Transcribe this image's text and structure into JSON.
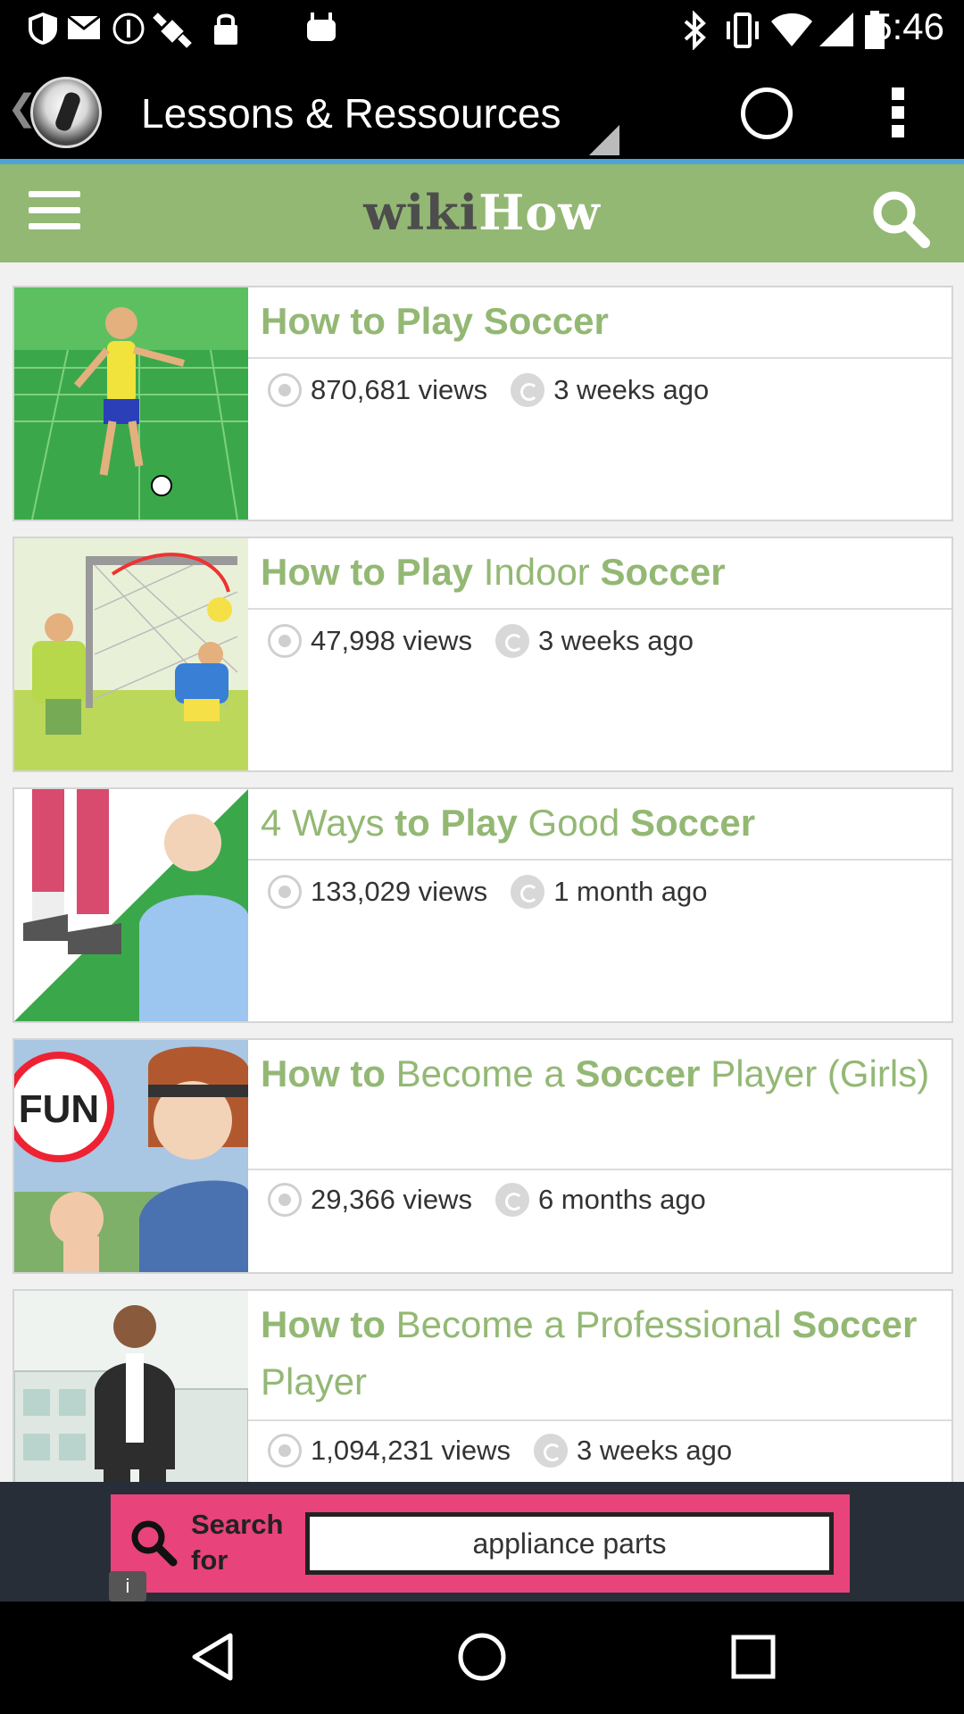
{
  "status_bar": {
    "time": "5:46",
    "left_icons": [
      "shield-icon",
      "gmail-icon",
      "info-icon",
      "fake-gps-icon",
      "lock-icon",
      "android-icon"
    ],
    "right_icons": [
      "bluetooth-icon",
      "vibrate-icon",
      "wifi-icon",
      "signal-icon",
      "battery-icon"
    ]
  },
  "app_bar": {
    "title": "Lessons & Ressources"
  },
  "wiki_header": {
    "logo_wiki": "wiki",
    "logo_how": "How",
    "brand_green": "#93b874"
  },
  "articles": [
    {
      "title_parts": [
        [
          "b",
          "How to Play Soccer"
        ]
      ],
      "views": "870,681 views",
      "time": "3 weeks ago"
    },
    {
      "title_parts": [
        [
          "b",
          "How to Play "
        ],
        [
          "n",
          "Indoor "
        ],
        [
          "b",
          "Soccer"
        ]
      ],
      "views": "47,998 views",
      "time": "3 weeks ago"
    },
    {
      "title_parts": [
        [
          "n",
          "4 Ways "
        ],
        [
          "b",
          "to Play "
        ],
        [
          "n",
          "Good "
        ],
        [
          "b",
          "Soccer"
        ]
      ],
      "views": "133,029 views",
      "time": "1 month ago"
    },
    {
      "title_parts": [
        [
          "b",
          "How to "
        ],
        [
          "n",
          "Become a "
        ],
        [
          "b",
          "Soccer "
        ],
        [
          "n",
          "Player (Girls)"
        ]
      ],
      "views": "29,366 views",
      "time": "6 months ago"
    },
    {
      "title_parts": [
        [
          "b",
          "How to "
        ],
        [
          "n",
          "Become a Professional "
        ],
        [
          "b",
          "Soccer "
        ],
        [
          "n",
          "Player"
        ]
      ],
      "views": "1,094,231 views",
      "time": "3 weeks ago"
    }
  ],
  "ad": {
    "label_line1": "Search",
    "label_line2": "for",
    "input_value": "appliance parts",
    "info": "i"
  }
}
